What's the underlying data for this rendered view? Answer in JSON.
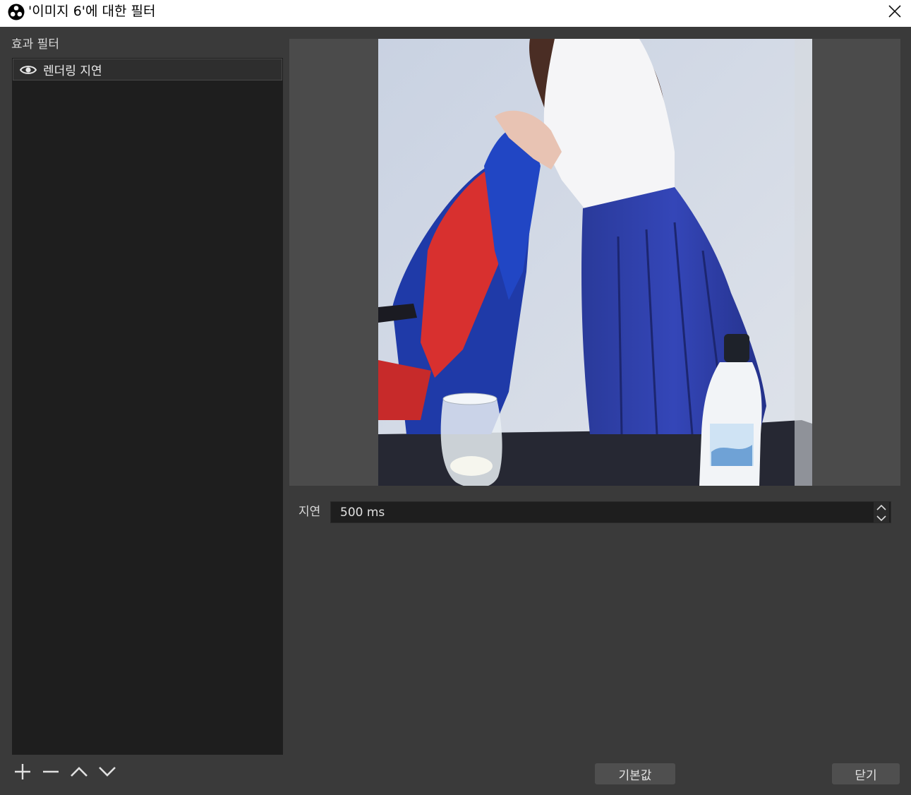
{
  "window": {
    "title": "'이미지 6'에 대한 필터"
  },
  "effect_filters": {
    "heading": "효과 필터",
    "items": [
      {
        "label": "렌더링 지연",
        "visible": true
      }
    ]
  },
  "list_controls": {
    "add": "add-icon",
    "remove": "remove-icon",
    "move_up": "chevron-up-icon",
    "move_down": "chevron-down-icon"
  },
  "properties": {
    "delay_label": "지연",
    "delay_value": "500 ms"
  },
  "buttons": {
    "defaults": "기본값",
    "close": "닫기"
  },
  "colors": {
    "background": "#3a3a3a",
    "list_background": "#1e1e1e",
    "titlebar": "#ffffff",
    "button": "#4f4f4f"
  }
}
